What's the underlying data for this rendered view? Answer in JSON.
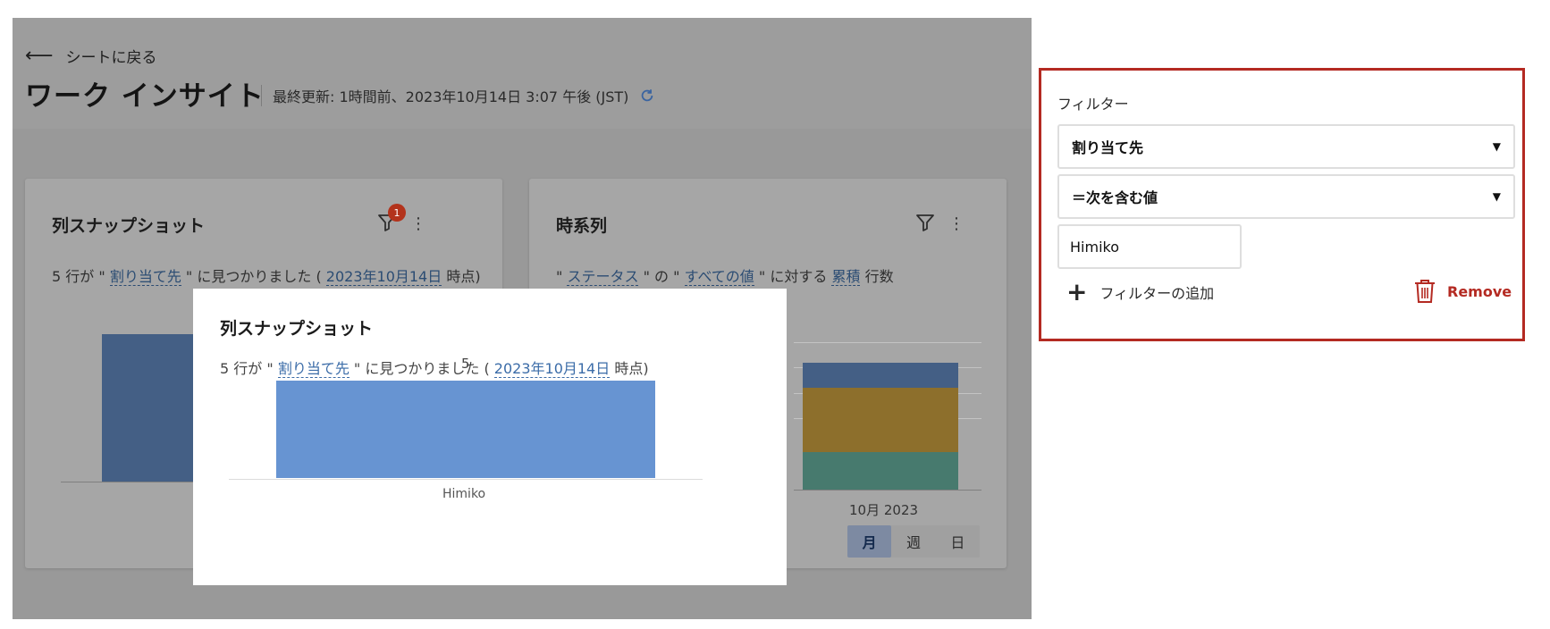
{
  "header": {
    "back_label": "シートに戻る",
    "title": "ワーク インサイト",
    "last_updated": "最終更新: 1時間前、2023年10月14日 3:07 午後 (JST)"
  },
  "cards": {
    "column_snapshot": {
      "title": "列スナップショット",
      "filter_badge": "1",
      "desc_prefix": "5 行が \"",
      "desc_field": "割り当て先",
      "desc_mid": "\" に見つかりました (",
      "desc_date": "2023年10月14日",
      "desc_suffix": "時点)"
    },
    "time_series": {
      "title": "時系列",
      "desc_q1": "\"",
      "desc_field": "ステータス",
      "desc_of": "\" の \"",
      "desc_values": "すべての値",
      "desc_for": "\" に対する",
      "desc_mode": "累積",
      "desc_rows": "行数",
      "x_label": "10月 2023",
      "periods": [
        "月",
        "週",
        "日"
      ],
      "active_period": "月"
    }
  },
  "popup": {
    "title": "列スナップショット",
    "desc_prefix": "5 行が \"",
    "desc_field": "割り当て先",
    "desc_mid": "\" に見つかりました (",
    "desc_date": "2023年10月14日",
    "desc_suffix": "時点)"
  },
  "chart_data": {
    "type": "bar",
    "categories": [
      "Himiko"
    ],
    "values": [
      5
    ],
    "ylim": [
      0,
      5.8
    ],
    "colors": {
      "bar": "#6794d2"
    }
  },
  "filter_panel": {
    "label": "フィルター",
    "field_select": "割り当て先",
    "operator_select": "＝次を含む値",
    "value_input": "Himiko",
    "add_filter_label": "フィルターの追加",
    "remove_label": "Remove"
  },
  "colors": {
    "accent_red": "#b42a22",
    "link_blue": "#3b6ca8",
    "series_blue": "#445f85",
    "series_gold": "#8d6f2c",
    "series_teal": "#477a6e"
  }
}
